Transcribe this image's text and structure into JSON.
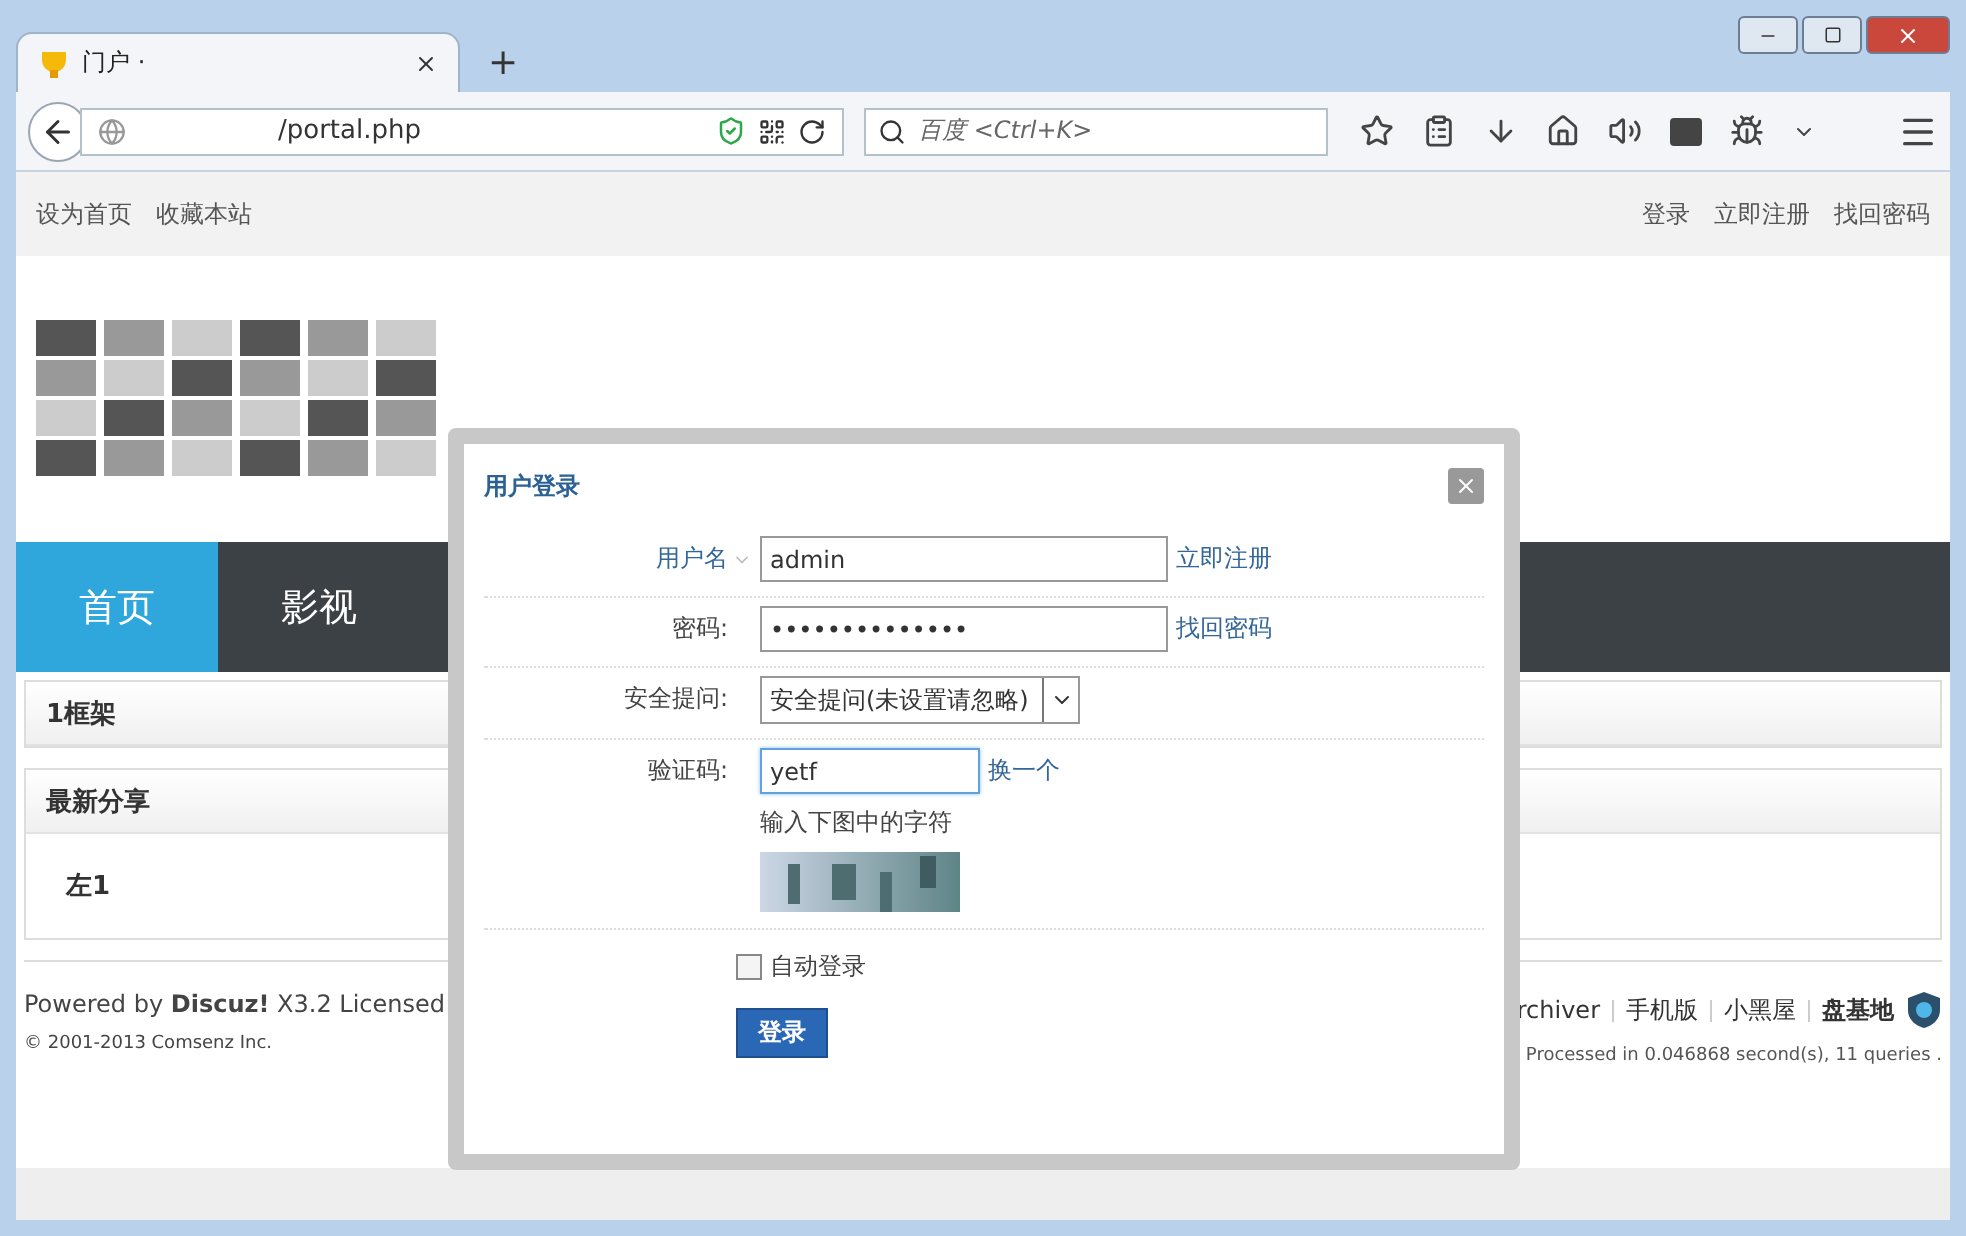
{
  "browser": {
    "tab_title": "门户 ·",
    "new_tab": "+",
    "address": "/portal.php",
    "search_placeholder": "百度 <Ctrl+K>"
  },
  "topbar": {
    "left_links": [
      "设为首页",
      "收藏本站"
    ],
    "right_links": [
      "登录",
      "立即注册",
      "找回密码"
    ]
  },
  "nav": [
    {
      "label": "首页",
      "selected": true
    },
    {
      "label": "影视",
      "selected": false
    }
  ],
  "blocks": [
    {
      "title": "1框架"
    },
    {
      "title": "最新分享",
      "items": [
        "左1"
      ]
    }
  ],
  "footer": {
    "powered": "Powered by **Discuz!** X3.2 Licensed",
    "copyright": "© 2001-2013 Comsenz Inc.",
    "links": [
      "rchiver",
      "手机版",
      "小黑屋",
      "盘基地"
    ],
    "stats": "Processed in 0.046868 second(s), 11 queries ."
  },
  "dialog": {
    "title": "用户登录",
    "fields": [
      {
        "kind": "text",
        "label": "用户名",
        "value": "admin",
        "link": "立即注册"
      },
      {
        "kind": "password",
        "label": "密码:",
        "value": "••••••••••••••",
        "link": "找回密码"
      },
      {
        "kind": "select",
        "label": "安全提问:",
        "value": "安全提问(未设置请忽略)"
      },
      {
        "kind": "captcha",
        "label": "验证码:",
        "value": "yetf",
        "link": "换一个",
        "hint": "输入下图中的字符"
      }
    ],
    "auto_login": {
      "label": "自动登录",
      "checked": false
    },
    "submit": "登录"
  }
}
